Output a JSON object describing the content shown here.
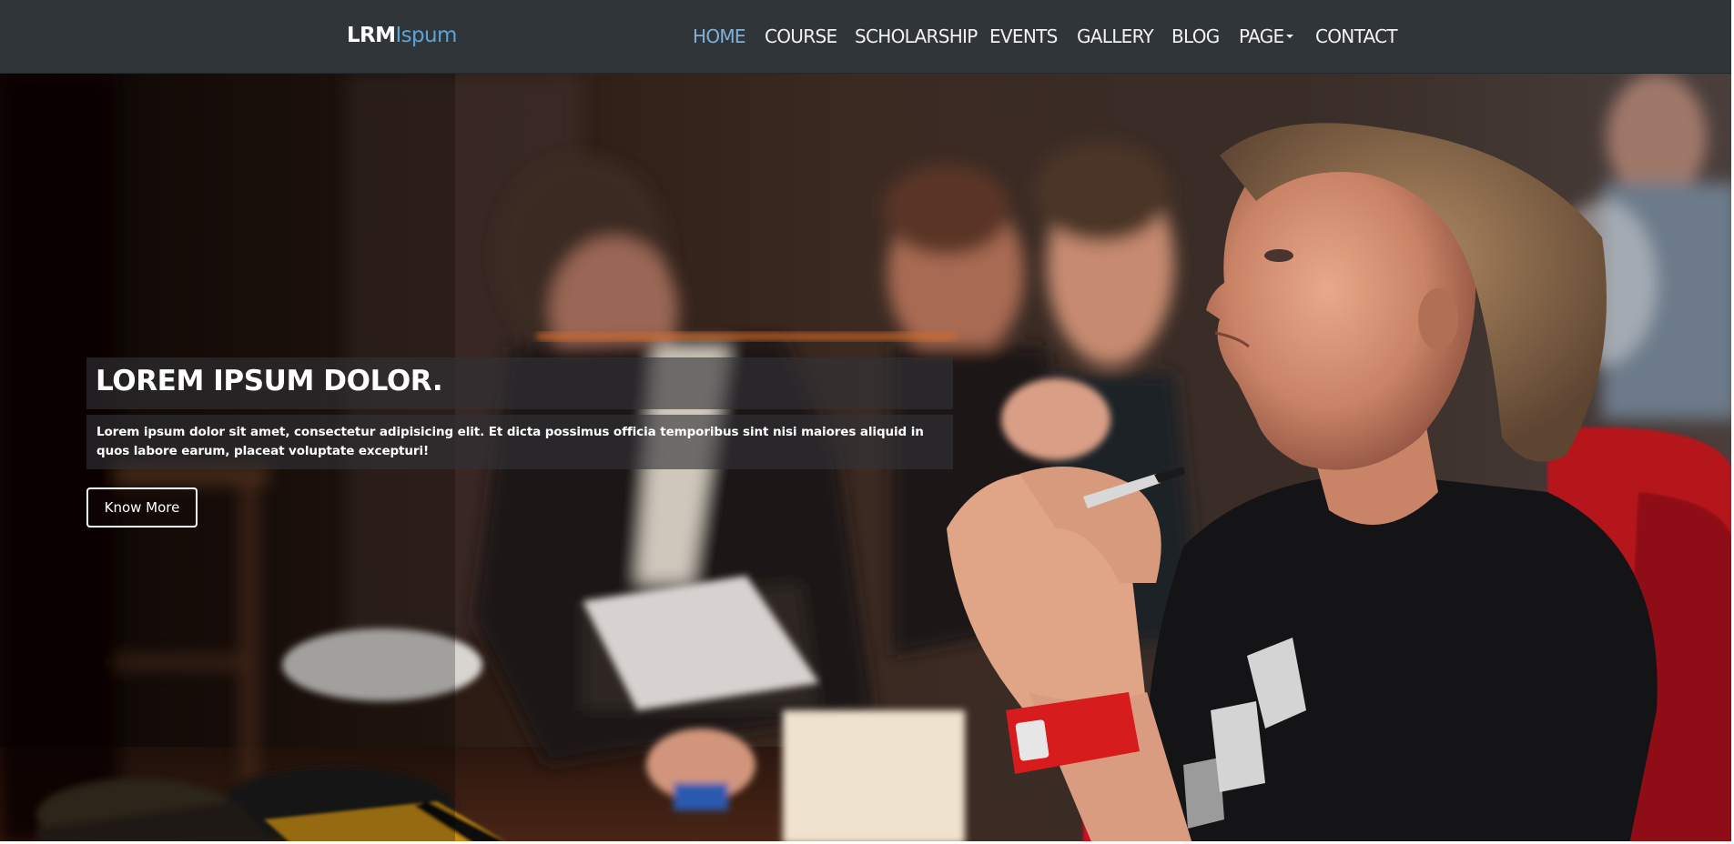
{
  "brand": {
    "part1": "LRM",
    "part2": "Ispum"
  },
  "nav": {
    "items": [
      {
        "label": "HOME",
        "active": true
      },
      {
        "label": "COURSE",
        "active": false
      },
      {
        "label": "SCHOLARSHIP",
        "active": false
      },
      {
        "label": "EVENTS",
        "active": false
      },
      {
        "label": "GALLERY",
        "active": false
      },
      {
        "label": "BLOG",
        "active": false
      },
      {
        "label": "PAGE",
        "active": false,
        "has_dropdown": true
      },
      {
        "label": "CONTACT",
        "active": false
      }
    ]
  },
  "hero": {
    "title": "LOREM IPSUM DOLOR.",
    "text": "Lorem ipsum dolor sit amet, consectetur adipisicing elit. Et dicta possimus officia temporibus sint nisi maiores aliquid in quos labore earum, placeat voluptate excepturi!",
    "button_label": "Know More"
  },
  "colors": {
    "navbar_bg": "#2f3539",
    "nav_active": "#7fb2d8",
    "brand_accent": "#5fa3d3",
    "caption_bg": "rgba(50,50,55,0.62)"
  }
}
